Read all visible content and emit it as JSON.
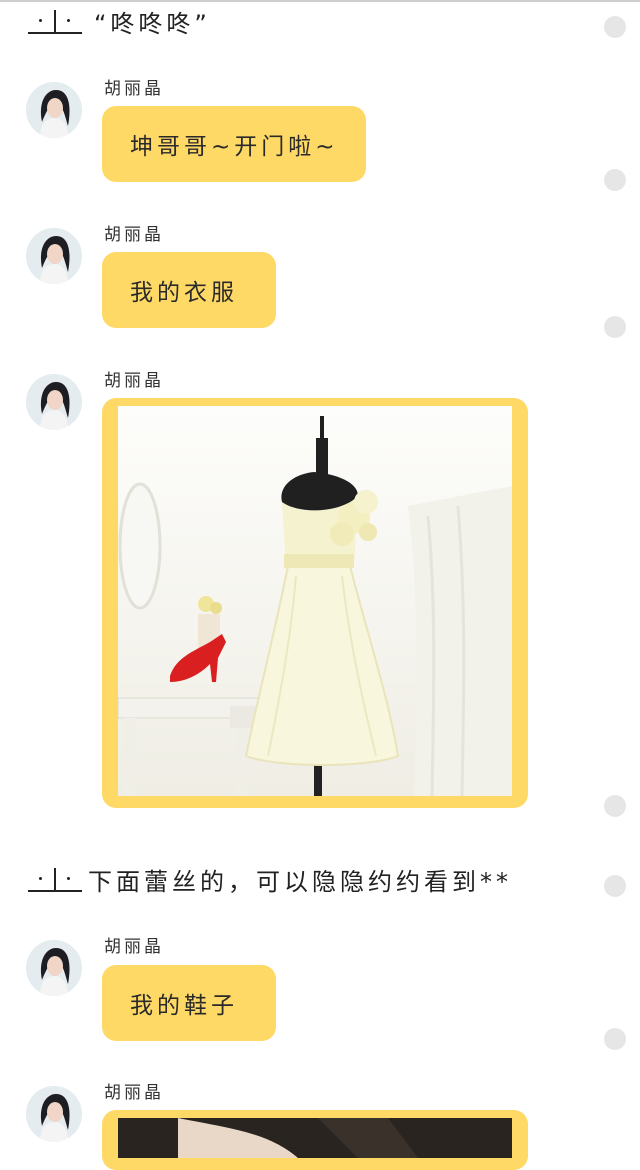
{
  "messages": {
    "narration_1": "“咚咚咚”",
    "narration_2": "下面蕾丝的，可以隐隐约约看到**",
    "sender_name": "胡丽晶",
    "bubble_1": "坤哥哥~开门啦~",
    "bubble_2": "我的衣服",
    "bubble_3": "我的鞋子"
  },
  "theme": {
    "bubble_color": "#ffd966",
    "read_dot_color": "#e6e6e6"
  },
  "icons": [
    "avatar-image",
    "dress-photo",
    "read-status-dot"
  ]
}
